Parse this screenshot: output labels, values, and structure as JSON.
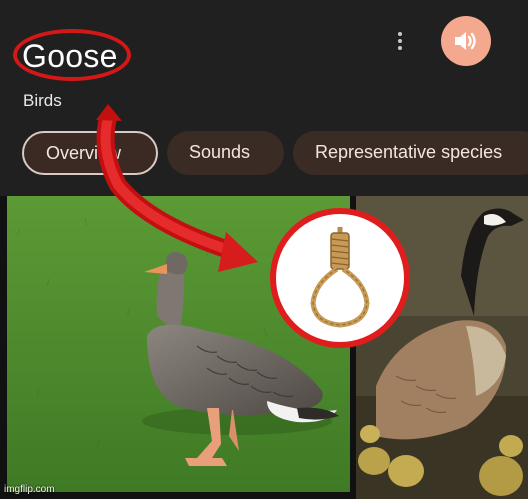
{
  "header": {
    "title": "Goose",
    "subtitle": "Birds"
  },
  "tabs": [
    {
      "label": "Overview",
      "active": true
    },
    {
      "label": "Sounds",
      "active": false
    },
    {
      "label": "Representative species",
      "active": false
    }
  ],
  "icons": {
    "more": "more-vert-icon",
    "sound": "volume-icon",
    "noose": "noose-icon",
    "arrow": "red-curved-arrow"
  },
  "colors": {
    "background": "#1f1f1f",
    "accent_button": "#f4a98f",
    "chip_bg": "#3a2b25",
    "annotation_red": "#e01d1d"
  },
  "watermark": "imgflip.com"
}
